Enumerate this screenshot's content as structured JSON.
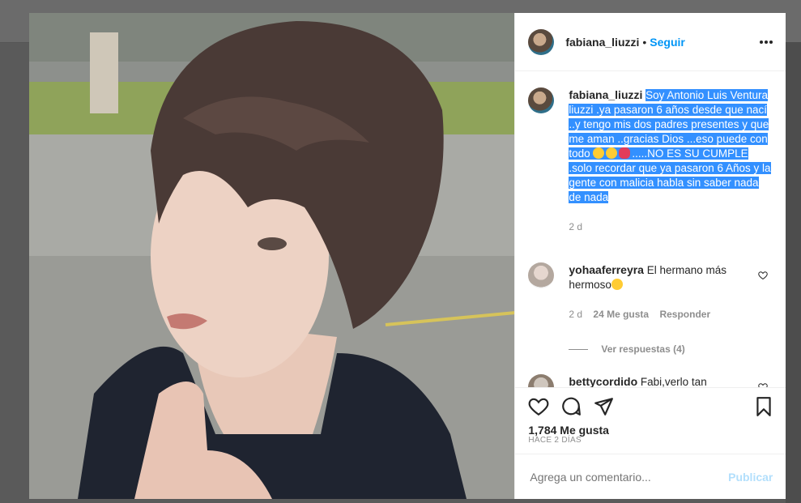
{
  "post": {
    "username": "fabiana_liuzzi",
    "follow_label": "Seguir",
    "caption_username": "fabiana_liuzzi",
    "caption_part1": "Soy Antonio Luis Ventura liuzzi .ya pasaron 6 años desde que nací ..y tengo mis dos padres presentes y que me aman ..gracias Dios ...eso puede con todo",
    "caption_part2": ".....NO ES SU CUMPLE .solo recordar que ya pasaron 6 Años y la gente con malicia habla sin saber nada de nada",
    "caption_time": "2 d",
    "likes": "1,784 Me gusta",
    "posted_ago": "HACE 2 DÍAS"
  },
  "comments": [
    {
      "username": "yohaaferreyra",
      "text": "El hermano más hermoso",
      "time": "2 d",
      "likes": "24 Me gusta",
      "reply_label": "Responder",
      "view_replies": "Ver respuestas (4)"
    },
    {
      "username": "bettycordido",
      "text": "Fabi,verlo tan"
    }
  ],
  "add_comment": {
    "placeholder": "Agrega un comentario...",
    "publish_label": "Publicar"
  },
  "icons": [
    "more-icon",
    "heart-icon",
    "comment-icon",
    "share-icon",
    "bookmark-icon"
  ]
}
